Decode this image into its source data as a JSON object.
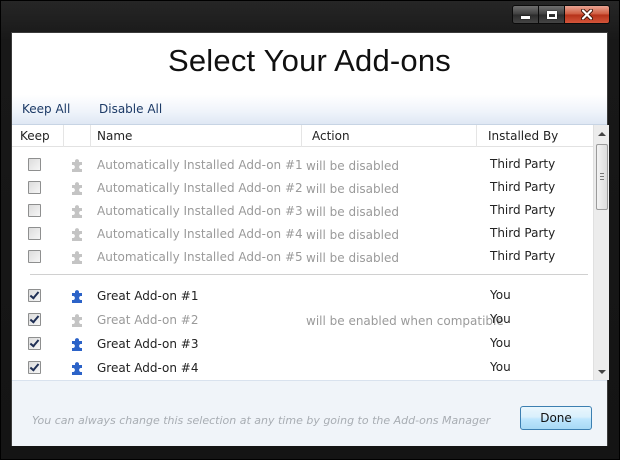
{
  "window": {
    "title": "Select Your Add-ons"
  },
  "toolbar": {
    "keep_all": "Keep All",
    "disable_all": "Disable All"
  },
  "columns": {
    "keep": "Keep",
    "name": "Name",
    "action": "Action",
    "installed_by": "Installed By"
  },
  "rows": [
    {
      "checked": false,
      "enabled_icon": false,
      "name": "Automatically Installed Add-on #1",
      "action": "will be disabled",
      "installed_by": "Third Party",
      "disabled": true
    },
    {
      "checked": false,
      "enabled_icon": false,
      "name": "Automatically Installed Add-on #2",
      "action": "will be disabled",
      "installed_by": "Third Party",
      "disabled": true
    },
    {
      "checked": false,
      "enabled_icon": false,
      "name": "Automatically Installed Add-on #3",
      "action": "will be disabled",
      "installed_by": "Third Party",
      "disabled": true
    },
    {
      "checked": false,
      "enabled_icon": false,
      "name": "Automatically Installed Add-on #4",
      "action": "will be disabled",
      "installed_by": "Third Party",
      "disabled": true
    },
    {
      "checked": false,
      "enabled_icon": false,
      "name": "Automatically Installed Add-on #5",
      "action": "will be disabled",
      "installed_by": "Third Party",
      "disabled": true
    },
    {
      "checked": true,
      "enabled_icon": true,
      "name": "Great Add-on #1",
      "action": "",
      "installed_by": "You",
      "disabled": false
    },
    {
      "checked": true,
      "enabled_icon": false,
      "name": "Great Add-on #2",
      "action": "will be enabled when compatible",
      "installed_by": "You",
      "disabled": true
    },
    {
      "checked": true,
      "enabled_icon": true,
      "name": "Great Add-on #3",
      "action": "",
      "installed_by": "You",
      "disabled": false
    },
    {
      "checked": true,
      "enabled_icon": true,
      "name": "Great Add-on #4",
      "action": "",
      "installed_by": "You",
      "disabled": false
    }
  ],
  "footer": {
    "hint": "You can always change this selection at any time by going to the Add-ons Manager",
    "done_label": "Done"
  },
  "icons": {
    "enabled_addon": "puzzle-piece-blue",
    "disabled_addon": "puzzle-piece-gray",
    "enabled_color": "#2c63c8",
    "disabled_color": "#c4c4c4"
  }
}
